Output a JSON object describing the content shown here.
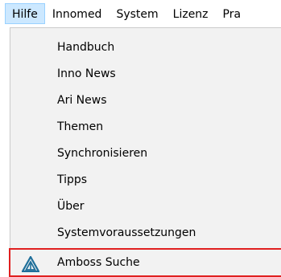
{
  "menubar": {
    "items": [
      {
        "label": "Hilfe",
        "active": true
      },
      {
        "label": "Innomed"
      },
      {
        "label": "System"
      },
      {
        "label": "Lizenz"
      },
      {
        "label": "Pra"
      }
    ]
  },
  "dropdown": {
    "items": [
      {
        "label": "Handbuch"
      },
      {
        "label": "Inno News"
      },
      {
        "label": "Ari News"
      },
      {
        "label": "Themen"
      },
      {
        "label": "Synchronisieren"
      },
      {
        "label": "Tipps"
      },
      {
        "label": "Über"
      },
      {
        "label": "Systemvoraussetzungen"
      },
      {
        "label": "Amboss Suche",
        "icon": "amboss-triangle-icon",
        "highlighted": true
      }
    ]
  },
  "colors": {
    "menu_active_bg": "#cce8ff",
    "dropdown_bg": "#f2f2f2",
    "highlight_border": "#e02020",
    "amboss_icon": "#1f6f9a"
  }
}
